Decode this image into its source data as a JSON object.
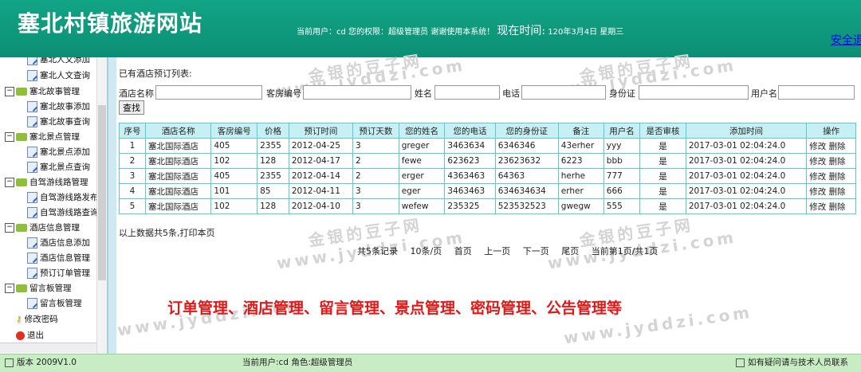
{
  "header": {
    "site_title": "塞北村镇旅游网站",
    "user_info": "当前用户：cd 您的权限：超级管理员 谢谢使用本系统！",
    "now_label": "现在时间:",
    "now_value": "120年3月4日 星期三",
    "exit_link": "安全退出"
  },
  "sidebar": {
    "items": [
      {
        "label": "塞北人文添加",
        "type": "leaf"
      },
      {
        "label": "塞北人文查询",
        "type": "leaf"
      },
      {
        "label": "塞北故事管理",
        "type": "group"
      },
      {
        "label": "塞北故事添加",
        "type": "leaf"
      },
      {
        "label": "塞北故事查询",
        "type": "leaf"
      },
      {
        "label": "塞北景点管理",
        "type": "group"
      },
      {
        "label": "塞北景点添加",
        "type": "leaf"
      },
      {
        "label": "塞北景点查询",
        "type": "leaf"
      },
      {
        "label": "自驾游线路管理",
        "type": "group"
      },
      {
        "label": "自驾游线路发布",
        "type": "leaf"
      },
      {
        "label": "自驾游线路查询",
        "type": "leaf"
      },
      {
        "label": "酒店信息管理",
        "type": "group"
      },
      {
        "label": "酒店信息添加",
        "type": "leaf"
      },
      {
        "label": "酒店信息管理",
        "type": "leaf"
      },
      {
        "label": "预订订单管理",
        "type": "leaf"
      },
      {
        "label": "留言板管理",
        "type": "group"
      },
      {
        "label": "留言板管理",
        "type": "leaf"
      },
      {
        "label": "修改密码",
        "type": "key"
      },
      {
        "label": "退出",
        "type": "exit"
      }
    ]
  },
  "main": {
    "list_title": "已有酒店预订列表:",
    "search": {
      "hotel_name": "酒店名称",
      "room_no": "客房编号",
      "name": "姓名",
      "phone": "电话",
      "id_card": "身份证",
      "username": "用户名",
      "button": "查找"
    },
    "table": {
      "headers": [
        "序号",
        "酒店名称",
        "客房编号",
        "价格",
        "预订时间",
        "预订天数",
        "您的姓名",
        "您的电话",
        "您的身份证",
        "备注",
        "用户名",
        "是否审核",
        "添加时间",
        "操作"
      ],
      "rows": [
        [
          "1",
          "塞北国际酒店",
          "405",
          "2355",
          "2012-04-25",
          "3",
          "greger",
          "3463634",
          "6346346",
          "43erher",
          "yyy",
          "是",
          "2017-03-01 02:04:24.0"
        ],
        [
          "2",
          "塞北国际酒店",
          "102",
          "128",
          "2012-04-17",
          "2",
          "fewe",
          "623623",
          "23623632",
          "6223",
          "bbb",
          "是",
          "2017-03-01 02:04:24.0"
        ],
        [
          "3",
          "塞北国际酒店",
          "405",
          "2355",
          "2012-04-14",
          "2",
          "erger",
          "4363463",
          "64363",
          "herhe",
          "777",
          "是",
          "2017-03-01 02:04:24.0"
        ],
        [
          "4",
          "塞北国际酒店",
          "101",
          "85",
          "2012-04-11",
          "3",
          "eger",
          "3463463",
          "634634634",
          "erher",
          "666",
          "是",
          "2017-03-01 02:04:24.0"
        ],
        [
          "5",
          "塞北国际酒店",
          "102",
          "128",
          "2012-04-10",
          "3",
          "wefew",
          "235325",
          "523532523",
          "gwegw",
          "555",
          "是",
          "2017-03-01 02:04:24.0"
        ]
      ],
      "edit_label": "修改",
      "delete_label": "删除"
    },
    "summary": "以上数据共5条,打印本页",
    "pager": {
      "total": "共5条记录",
      "per_page": "10条/页",
      "first": "首页",
      "prev": "上一页",
      "next": "下一页",
      "last": "尾页",
      "current": "当前第1页/共1页"
    },
    "banner": "订单管理、酒店管理、留言管理、景点管理、密码管理、公告管理等",
    "watermark_cn": "金银的豆子网",
    "watermark_en": "www.jyddzi.com"
  },
  "footer": {
    "version": "版本 2009V1.0",
    "current": "当前用户:cd   角色:超级管理员",
    "help": "如有疑问请与技术人员联系"
  },
  "colors": {
    "header_bg": "#12a486",
    "table_border": "#5bc8d8",
    "table_header_bg": "#c8f0f4",
    "banner_red": "#e01818",
    "footer_bg": "#c8ecc4"
  }
}
